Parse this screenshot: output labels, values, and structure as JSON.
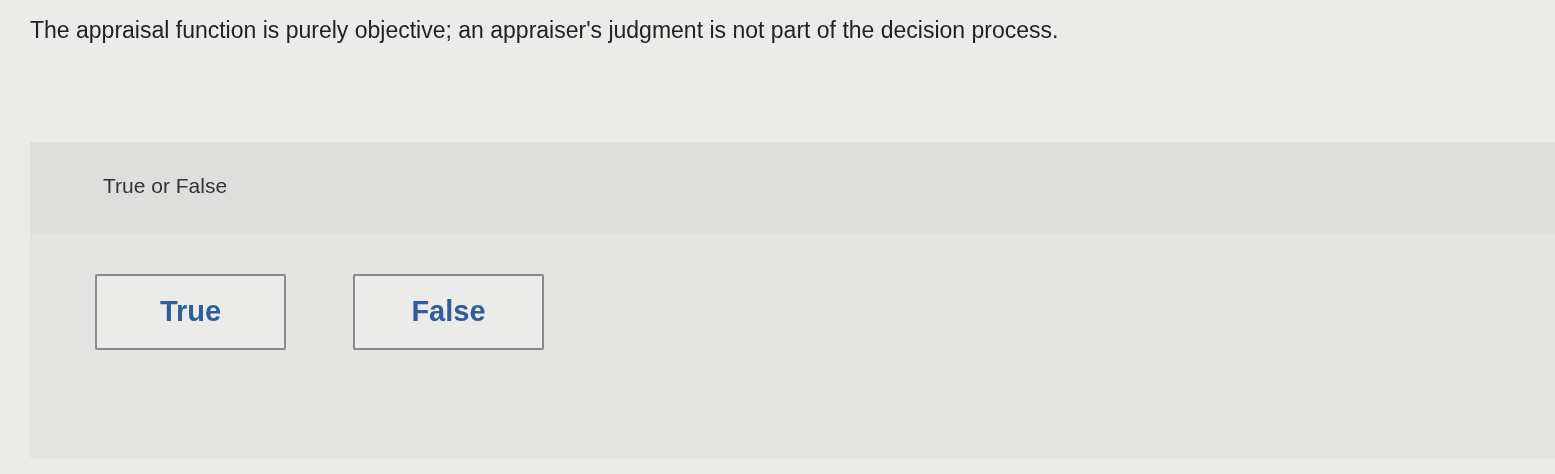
{
  "question": "The appraisal function is purely objective; an appraiser's judgment is not part of the decision process.",
  "prompt": "True or False",
  "options": [
    {
      "label": "True",
      "selected": false
    },
    {
      "label": "False",
      "selected": false
    }
  ]
}
